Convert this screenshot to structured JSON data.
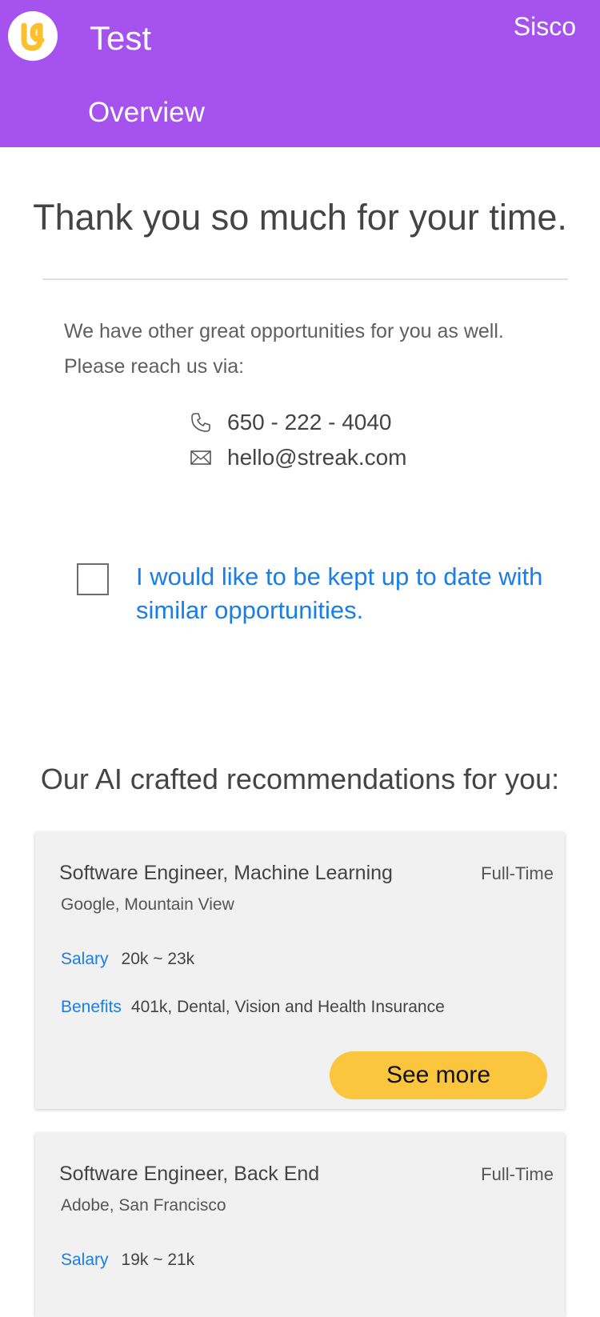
{
  "header": {
    "app_title": "Test",
    "user_name": "Sisco",
    "tab_label": "Overview",
    "brand_color": "#a652ef",
    "logo_icon": "brand-logo-icon"
  },
  "thank_you": {
    "heading": "Thank you so much for your time.",
    "intro_line1": "We have other great opportunities for you as well.",
    "intro_line2": "Please reach us via:"
  },
  "contact": {
    "phone": "650 - 222 - 4040",
    "phone_icon": "phone-icon",
    "email": "hello@streak.com",
    "email_icon": "email-icon"
  },
  "optin": {
    "checked": false,
    "label": "I would like to be kept up to date with similar opportunities.",
    "accent_color": "#1a7ee8"
  },
  "recommendations": {
    "title": "Our AI crafted recommendations for you:",
    "salary_label": "Salary",
    "benefits_label": "Benefits",
    "see_more_label": "See more",
    "button_color": "#fbc53d",
    "jobs": [
      {
        "title": "Software Engineer, Machine Learning",
        "type": "Full-Time",
        "company": "Google, Mountain View",
        "salary": "20k ~ 23k",
        "benefits": "401k, Dental, Vision and Health Insurance"
      },
      {
        "title": "Software Engineer, Back End",
        "type": "Full-Time",
        "company": "Adobe, San Francisco",
        "salary": "19k ~ 21k"
      }
    ]
  }
}
